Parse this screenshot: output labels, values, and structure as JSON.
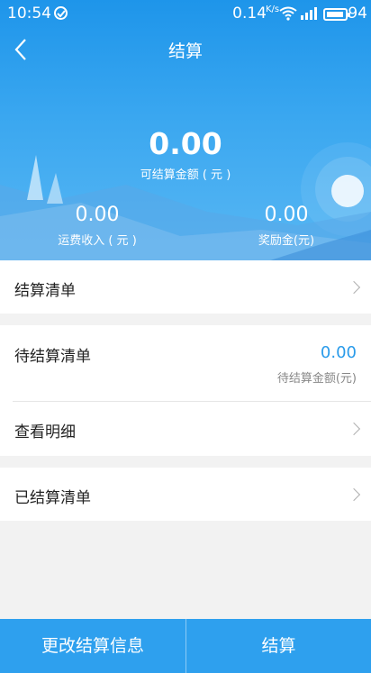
{
  "status_bar": {
    "time": "10:54",
    "speed": "0.14",
    "speed_unit": "K/s",
    "battery": "94"
  },
  "header": {
    "title": "结算"
  },
  "summary": {
    "available_amount": "0.00",
    "available_label": "可结算金额 ( 元 )",
    "freight_amount": "0.00",
    "freight_label": "运费收入 ( 元 )",
    "bonus_amount": "0.00",
    "bonus_label": "奖励金(元)"
  },
  "list": {
    "settlement_list": "结算清单",
    "pending_list": "待结算清单",
    "pending_amount": "0.00",
    "pending_amount_label": "待结算金额(元)",
    "view_details": "查看明细",
    "settled_list": "已结算清单"
  },
  "bottom_bar": {
    "change_info": "更改结算信息",
    "settle": "结算"
  },
  "colors": {
    "primary": "#2ea0ee",
    "accent_text": "#2a9bea"
  }
}
